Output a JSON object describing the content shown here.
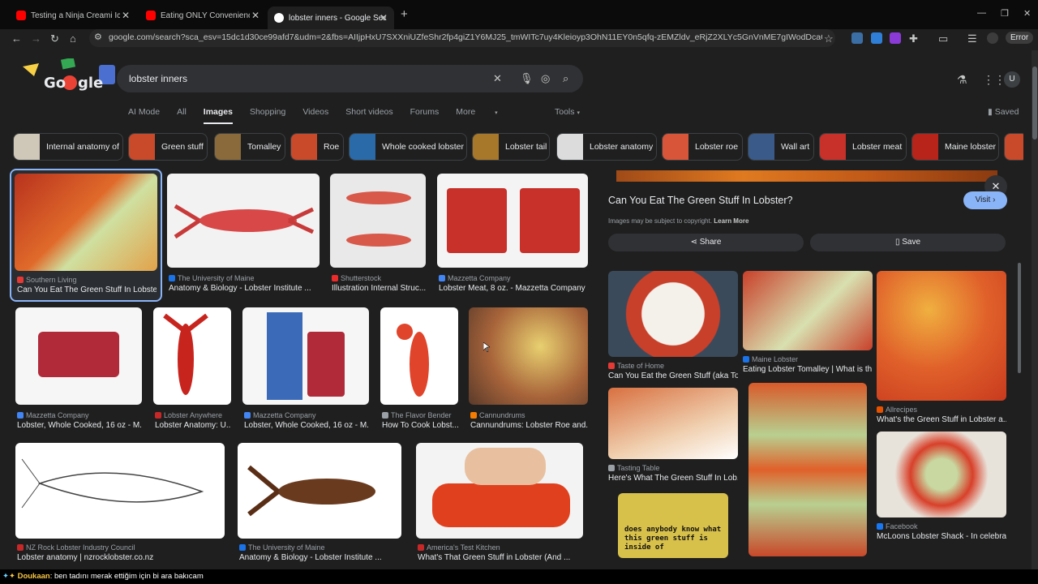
{
  "browser": {
    "tabs": [
      {
        "title": "Testing a Ninja Creami Ice Crea",
        "favicon_color": "#ff0000"
      },
      {
        "title": "Eating ONLY Convenience Store",
        "favicon_color": "#ff0000"
      },
      {
        "title": "lobster inners - Google Search",
        "favicon_color": "#ffffff"
      }
    ],
    "new_tab": "+",
    "url": "google.com/search?sca_esv=15dc1d30ce99afd7&udm=2&fbs=AIIjpHxU7SXXniUZfeShr2fp4giZ1Y6MJ25_tmWITc7uy4Kleioyp3OhN11EY0n5qfq-zEMZldv_eRjZ2XLYc5GnVnME7gIWodDcaQwvGY/tospyF4hao4Voc...",
    "error_label": "Error"
  },
  "search": {
    "query": "lobster inners",
    "tabs": [
      "AI Mode",
      "All",
      "Images",
      "Shopping",
      "Videos",
      "Short videos",
      "Forums",
      "More"
    ],
    "selected_tab": "Images",
    "tools": "Tools",
    "saved": "Saved"
  },
  "chips": [
    {
      "label": "Internal anatomy of",
      "color": "#cfc7b8"
    },
    {
      "label": "Green stuff",
      "color": "#c84a2a"
    },
    {
      "label": "Tomalley",
      "color": "#8a6a3a"
    },
    {
      "label": "Roe",
      "color": "#c84a2a"
    },
    {
      "label": "Whole cooked lobster",
      "color": "#2a6aa8"
    },
    {
      "label": "Lobster tail",
      "color": "#a8782a"
    },
    {
      "label": "Lobster anatomy",
      "color": "#dcdcdc"
    },
    {
      "label": "Lobster roe",
      "color": "#d8553a"
    },
    {
      "label": "Wall art",
      "color": "#3a5a8a"
    },
    {
      "label": "Lobster meat",
      "color": "#c8302a"
    },
    {
      "label": "Maine lobster",
      "color": "#b8241a"
    }
  ],
  "results": [
    {
      "source": "Southern Living",
      "title": "Can You Eat The Green Stuff In Lobste...",
      "src_color": "#e53935",
      "img_color": "#c8422a"
    },
    {
      "source": "The University of Maine",
      "title": "Anatomy & Biology - Lobster Institute ...",
      "src_color": "#1a73e8",
      "img_color": "#f2f2f2"
    },
    {
      "source": "Shutterstock",
      "title": "Illustration Internal Struc...",
      "src_color": "#ee2b2b",
      "img_color": "#e9e9e9"
    },
    {
      "source": "Mazzetta Company",
      "title": "Lobster Meat, 8 oz. - Mazzetta Company ...",
      "src_color": "#4285f4",
      "img_color": "#f4f4f4"
    },
    {
      "source": "Mazzetta Company",
      "title": "Lobster, Whole Cooked, 16 oz - M...",
      "src_color": "#4285f4",
      "img_color": "#f6f6f6"
    },
    {
      "source": "Lobster Anywhere",
      "title": "Lobster Anatomy: U...",
      "src_color": "#c62828",
      "img_color": "#ffffff"
    },
    {
      "source": "Mazzetta Company",
      "title": "Lobster, Whole Cooked, 16 oz - M...",
      "src_color": "#4285f4",
      "img_color": "#f6f6f6"
    },
    {
      "source": "The Flavor Bender",
      "title": "How To Cook Lobst...",
      "src_color": "#9aa0a6",
      "img_color": "#ffffff"
    },
    {
      "source": "Cannundrums",
      "title": "Cannundrums: Lobster Roe and...",
      "src_color": "#f57c00",
      "img_color": "#7a5a3a"
    },
    {
      "source": "NZ Rock Lobster Industry Council",
      "title": "Lobster anatomy | nzrocklobster.co.nz",
      "src_color": "#c62828",
      "img_color": "#ffffff"
    },
    {
      "source": "The University of Maine",
      "title": "Anatomy & Biology - Lobster Institute ...",
      "src_color": "#1a73e8",
      "img_color": "#ffffff"
    },
    {
      "source": "America's Test Kitchen",
      "title": "What's That Green Stuff in Lobster (And ...",
      "src_color": "#c62828",
      "img_color": "#f3f3f3"
    }
  ],
  "panel": {
    "title": "Can You Eat The Green Stuff In Lobster?",
    "visit": "Visit",
    "copyright": "Images may be subject to copyright.",
    "learn_more": "Learn More",
    "share": "Share",
    "save": "Save",
    "related": [
      {
        "source": "Taste of Home",
        "title": "Can You Eat the Green Stuff (aka To...",
        "src_color": "#e53935",
        "img_color": "#d9d4cc"
      },
      {
        "source": "Maine Lobster",
        "title": "Eating Lobster Tomalley | What is th...",
        "src_color": "#1a73e8",
        "img_color": "#c8402a"
      },
      {
        "source": "Allrecipes",
        "title": "What's the Green Stuff in Lobster a...",
        "src_color": "#e65100",
        "img_color": "#e0602a"
      },
      {
        "source": "Tasting Table",
        "title": "Here's What The Green Stuff In Lob...",
        "src_color": "#9aa0a6",
        "img_color": "#c8663a"
      },
      {
        "source": "Facebook",
        "title": "McLoons Lobster Shack - In celebra...",
        "src_color": "#1877f2",
        "img_color": "#e8e3da"
      },
      {
        "caption": "does anybody know what this green stuff is inside of",
        "img_color": "#d8c14a"
      }
    ]
  },
  "ticker": {
    "user": "Doukaan",
    "message": ": ben tadını merak ettiğim için bi ara bakıcam"
  }
}
